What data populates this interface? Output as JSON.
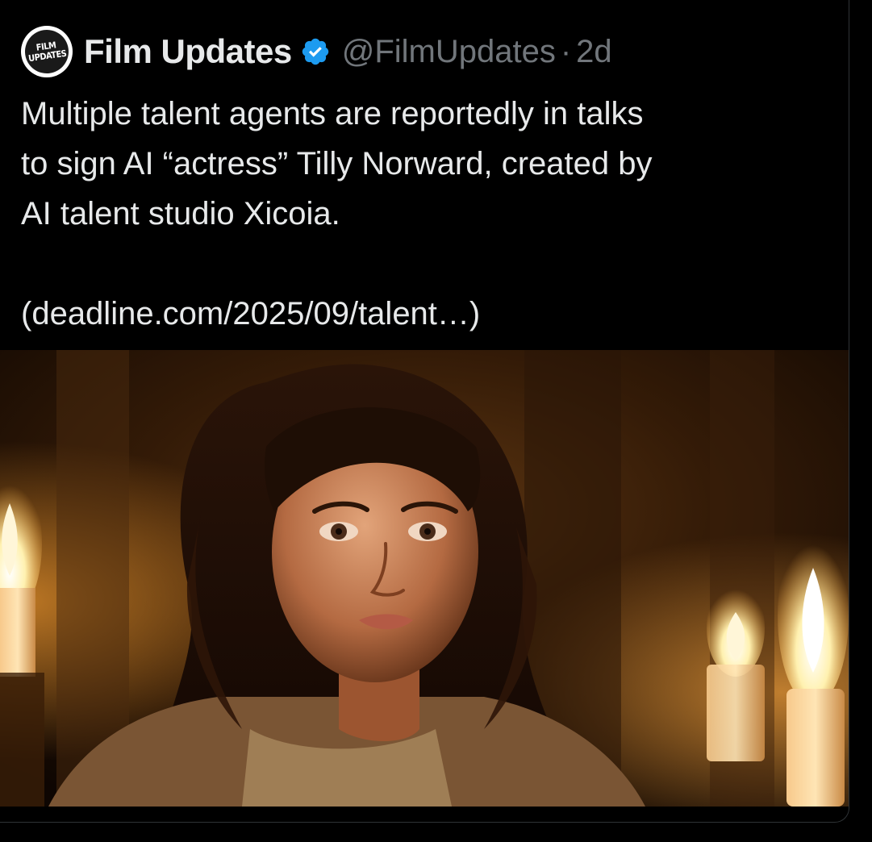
{
  "tweet": {
    "avatar_lines": [
      "FILM",
      "UPDATES"
    ],
    "display_name": "Film Updates",
    "verified_icon": "verified-badge-icon",
    "handle": "@FilmUpdates",
    "separator": "·",
    "time": "2d",
    "text": "Multiple talent agents are reportedly in talks\nto sign AI “actress” Tilly Norward, created by\nAI talent studio Xicoia.\n\n(deadline.com/2025/09/talent…)"
  },
  "media": {
    "description_icon": "portrait-photo-candles"
  },
  "colors": {
    "background": "#000000",
    "text_primary": "#e7e9ea",
    "text_secondary": "#71767b",
    "verified": "#1d9bf0",
    "border": "#2f3336"
  }
}
